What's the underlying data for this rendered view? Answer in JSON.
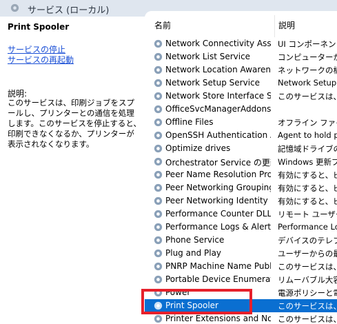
{
  "window": {
    "title": "サービス (ローカル)",
    "icon": "gear-icon"
  },
  "left_pane": {
    "service_name": "Print Spooler",
    "actions": [
      "サービスの停止",
      "サービスの再起動"
    ],
    "description_label": "説明:",
    "description": "このサービスは、印刷ジョブをスプールし、プリンターとの通信を処理します。このサービスを停止すると、印刷できなくなるか、プリンターが表示されなくなります。"
  },
  "list": {
    "columns": [
      "名前",
      "説明"
    ],
    "rows": [
      {
        "name": "Network Connectivity Assist...",
        "desc": "UI コンポーネントに"
      },
      {
        "name": "Network List Service",
        "desc": "コンピューターが接続"
      },
      {
        "name": "Network Location Awareness",
        "desc": "ネットワークの構成"
      },
      {
        "name": "Network Setup Service",
        "desc": "Network Setup Servi"
      },
      {
        "name": "Network Store Interface Ser...",
        "desc": "このサービスは、ネット"
      },
      {
        "name": "OfficeSvcManagerAddons",
        "desc": ""
      },
      {
        "name": "Offline Files",
        "desc": "オフライン ファイル サ"
      },
      {
        "name": "OpenSSH Authentication A...",
        "desc": "Agent to hold priva"
      },
      {
        "name": "Optimize drives",
        "desc": "記憶域ドライブのファ"
      },
      {
        "name": "Orchestrator Service の更新",
        "desc": "Windows 更新プログ"
      },
      {
        "name": "Peer Name Resolution Prot...",
        "desc": "有効にすると、ピア"
      },
      {
        "name": "Peer Networking Grouping",
        "desc": "有効にすると、ピア"
      },
      {
        "name": "Peer Networking Identity M...",
        "desc": "有効にすると、ピア"
      },
      {
        "name": "Performance Counter DLL H...",
        "desc": "リモート ユーザーおよ"
      },
      {
        "name": "Performance Logs & Alerts",
        "desc": "Performance Logs a"
      },
      {
        "name": "Phone Service",
        "desc": "デバイスのテレフォニ"
      },
      {
        "name": "Plug and Play",
        "desc": "ユーザーからの最小"
      },
      {
        "name": "PNRP Machine Name Publi...",
        "desc": "このサービスは、ピア"
      },
      {
        "name": "Portable Device Enumerator...",
        "desc": "リムーバブル大容量"
      },
      {
        "name": "Power",
        "desc": "電源ポリシーと電源"
      },
      {
        "name": "Print Spooler",
        "desc": "このサービスは、印",
        "selected": true
      },
      {
        "name": "Printer Extensions and Notif...",
        "desc": "このサービスは、プリ"
      }
    ]
  },
  "colors": {
    "selection": "#0a6fd1",
    "highlight_box": "#e6202b",
    "link": "#1a4fd6"
  }
}
